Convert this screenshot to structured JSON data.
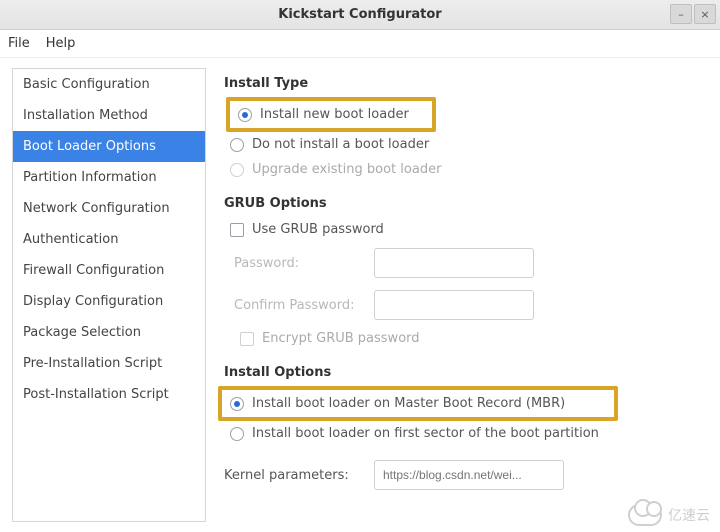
{
  "window": {
    "title": "Kickstart Configurator",
    "minimize_icon": "–",
    "close_icon": "×"
  },
  "menubar": {
    "file": "File",
    "help": "Help"
  },
  "sidebar": {
    "items": [
      {
        "label": "Basic Configuration"
      },
      {
        "label": "Installation Method"
      },
      {
        "label": "Boot Loader Options",
        "selected": true
      },
      {
        "label": "Partition Information"
      },
      {
        "label": "Network Configuration"
      },
      {
        "label": "Authentication"
      },
      {
        "label": "Firewall Configuration"
      },
      {
        "label": "Display Configuration"
      },
      {
        "label": "Package Selection"
      },
      {
        "label": "Pre-Installation Script"
      },
      {
        "label": "Post-Installation Script"
      }
    ]
  },
  "content": {
    "install_type": {
      "title": "Install Type",
      "options": {
        "install_new": {
          "label": "Install new boot loader",
          "checked": true,
          "highlight": true
        },
        "do_not_install": {
          "label": "Do not install a boot loader",
          "checked": false
        },
        "upgrade": {
          "label": "Upgrade existing boot loader",
          "checked": false,
          "disabled": true
        }
      }
    },
    "grub": {
      "title": "GRUB Options",
      "use_password": {
        "label": "Use GRUB password",
        "checked": false
      },
      "password_label": "Password:",
      "confirm_label": "Confirm Password:",
      "encrypt": {
        "label": "Encrypt GRUB password",
        "checked": false,
        "disabled": true
      }
    },
    "install_options": {
      "title": "Install Options",
      "mbr": {
        "label": "Install boot loader on Master Boot Record (MBR)",
        "checked": true,
        "highlight": true
      },
      "first_sector": {
        "label": "Install boot loader on first sector of the boot partition",
        "checked": false
      }
    },
    "kernel": {
      "label": "Kernel parameters:",
      "placeholder": "https://blog.csdn.net/wei..."
    }
  },
  "watermark_text": "亿速云"
}
